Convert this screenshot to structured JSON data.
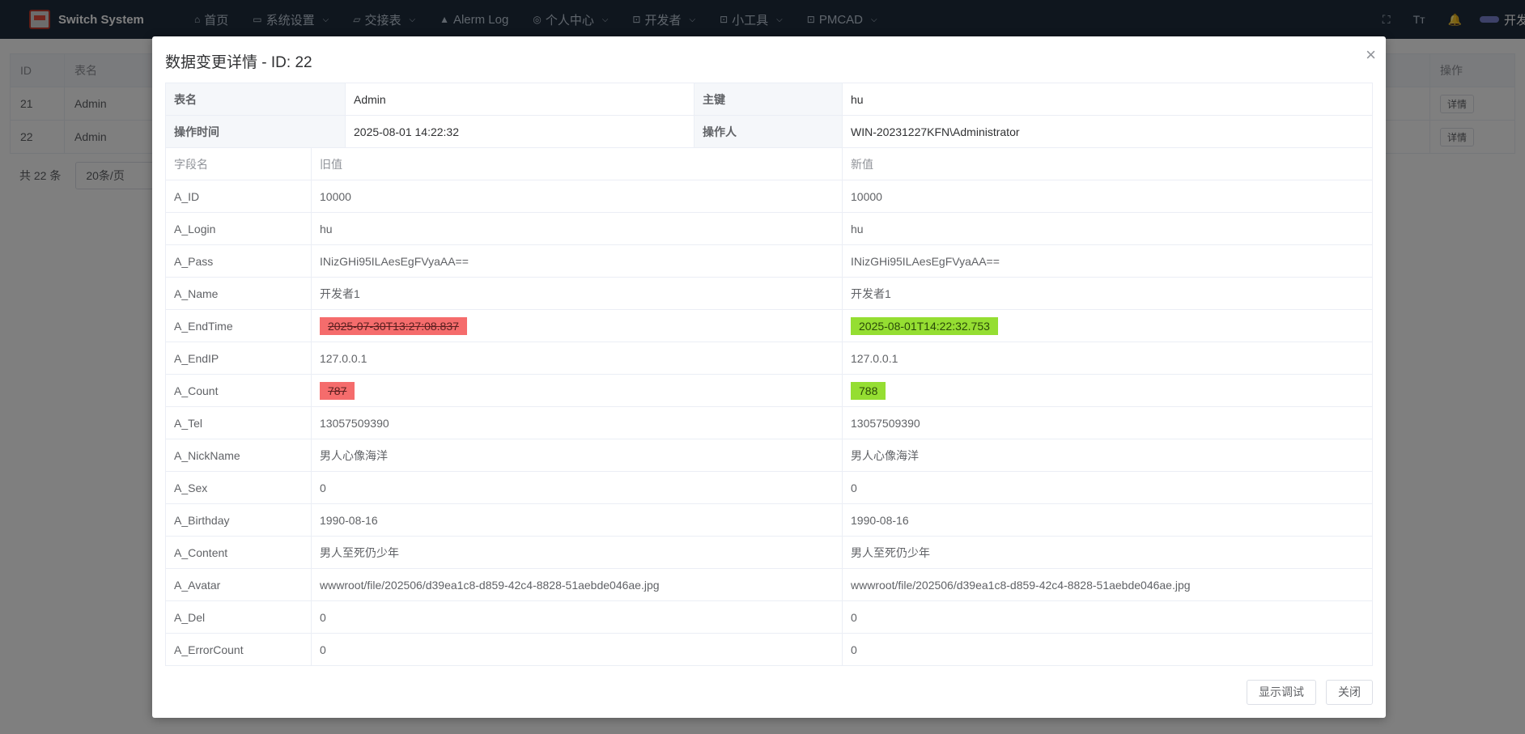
{
  "app": {
    "brand": "Switch System"
  },
  "nav": [
    {
      "icon": "⌂",
      "label": "首页",
      "chevron": false
    },
    {
      "icon": "▭",
      "label": "系统设置",
      "chevron": true
    },
    {
      "icon": "▱",
      "label": "交接表",
      "chevron": true
    },
    {
      "icon": "▲",
      "label": "Alerm Log",
      "chevron": false
    },
    {
      "icon": "◎",
      "label": "个人中心",
      "chevron": true
    },
    {
      "icon": "⊡",
      "label": "开发者",
      "chevron": true
    },
    {
      "icon": "⊡",
      "label": "小工具",
      "chevron": true
    },
    {
      "icon": "⊡",
      "label": "PMCAD",
      "chevron": true
    }
  ],
  "toolbar": {
    "fullscreen_icon": "⛶",
    "font_icon": "Tт",
    "bell_icon": "🔔",
    "user_label": "开发"
  },
  "bg": {
    "headers": [
      "ID",
      "表名",
      "操作"
    ],
    "rows": [
      {
        "id": "21",
        "table": "Admin",
        "action": "详情"
      },
      {
        "id": "22",
        "table": "Admin",
        "action": "详情"
      }
    ],
    "total": "共 22 条",
    "page_size": "20条/页"
  },
  "dialog": {
    "title": "数据变更详情 - ID: 22",
    "close_icon": "×",
    "info": {
      "table_name_label": "表名",
      "table_name": "Admin",
      "primary_key_label": "主键",
      "primary_key": "hu",
      "op_time_label": "操作时间",
      "op_time": "2025-08-01 14:22:32",
      "operator_label": "操作人",
      "operator": "WIN-20231227KFN\\Administrator"
    },
    "diff_headers": {
      "field": "字段名",
      "old": "旧值",
      "new": "新值"
    },
    "rows": [
      {
        "field": "A_ID",
        "old": "10000",
        "new": "10000",
        "changed": false
      },
      {
        "field": "A_Login",
        "old": "hu",
        "new": "hu",
        "changed": false
      },
      {
        "field": "A_Pass",
        "old": "INizGHi95ILAesEgFVyaAA==",
        "new": "INizGHi95ILAesEgFVyaAA==",
        "changed": false
      },
      {
        "field": "A_Name",
        "old": "开发者1",
        "new": "开发者1",
        "changed": false
      },
      {
        "field": "A_EndTime",
        "old": "2025-07-30T13:27:08.837",
        "new": "2025-08-01T14:22:32.753",
        "changed": true
      },
      {
        "field": "A_EndIP",
        "old": "127.0.0.1",
        "new": "127.0.0.1",
        "changed": false
      },
      {
        "field": "A_Count",
        "old": "787",
        "new": "788",
        "changed": true
      },
      {
        "field": "A_Tel",
        "old": "13057509390",
        "new": "13057509390",
        "changed": false
      },
      {
        "field": "A_NickName",
        "old": "男人心像海洋",
        "new": "男人心像海洋",
        "changed": false
      },
      {
        "field": "A_Sex",
        "old": "0",
        "new": "0",
        "changed": false
      },
      {
        "field": "A_Birthday",
        "old": "1990-08-16",
        "new": "1990-08-16",
        "changed": false
      },
      {
        "field": "A_Content",
        "old": "男人至死仍少年",
        "new": "男人至死仍少年",
        "changed": false
      },
      {
        "field": "A_Avatar",
        "old": "wwwroot/file/202506/d39ea1c8-d859-42c4-8828-51aebde046ae.jpg",
        "new": "wwwroot/file/202506/d39ea1c8-d859-42c4-8828-51aebde046ae.jpg",
        "changed": false
      },
      {
        "field": "A_Del",
        "old": "0",
        "new": "0",
        "changed": false
      },
      {
        "field": "A_ErrorCount",
        "old": "0",
        "new": "0",
        "changed": false
      }
    ],
    "footer": {
      "debug_label": "显示调试",
      "close_label": "关闭"
    }
  }
}
